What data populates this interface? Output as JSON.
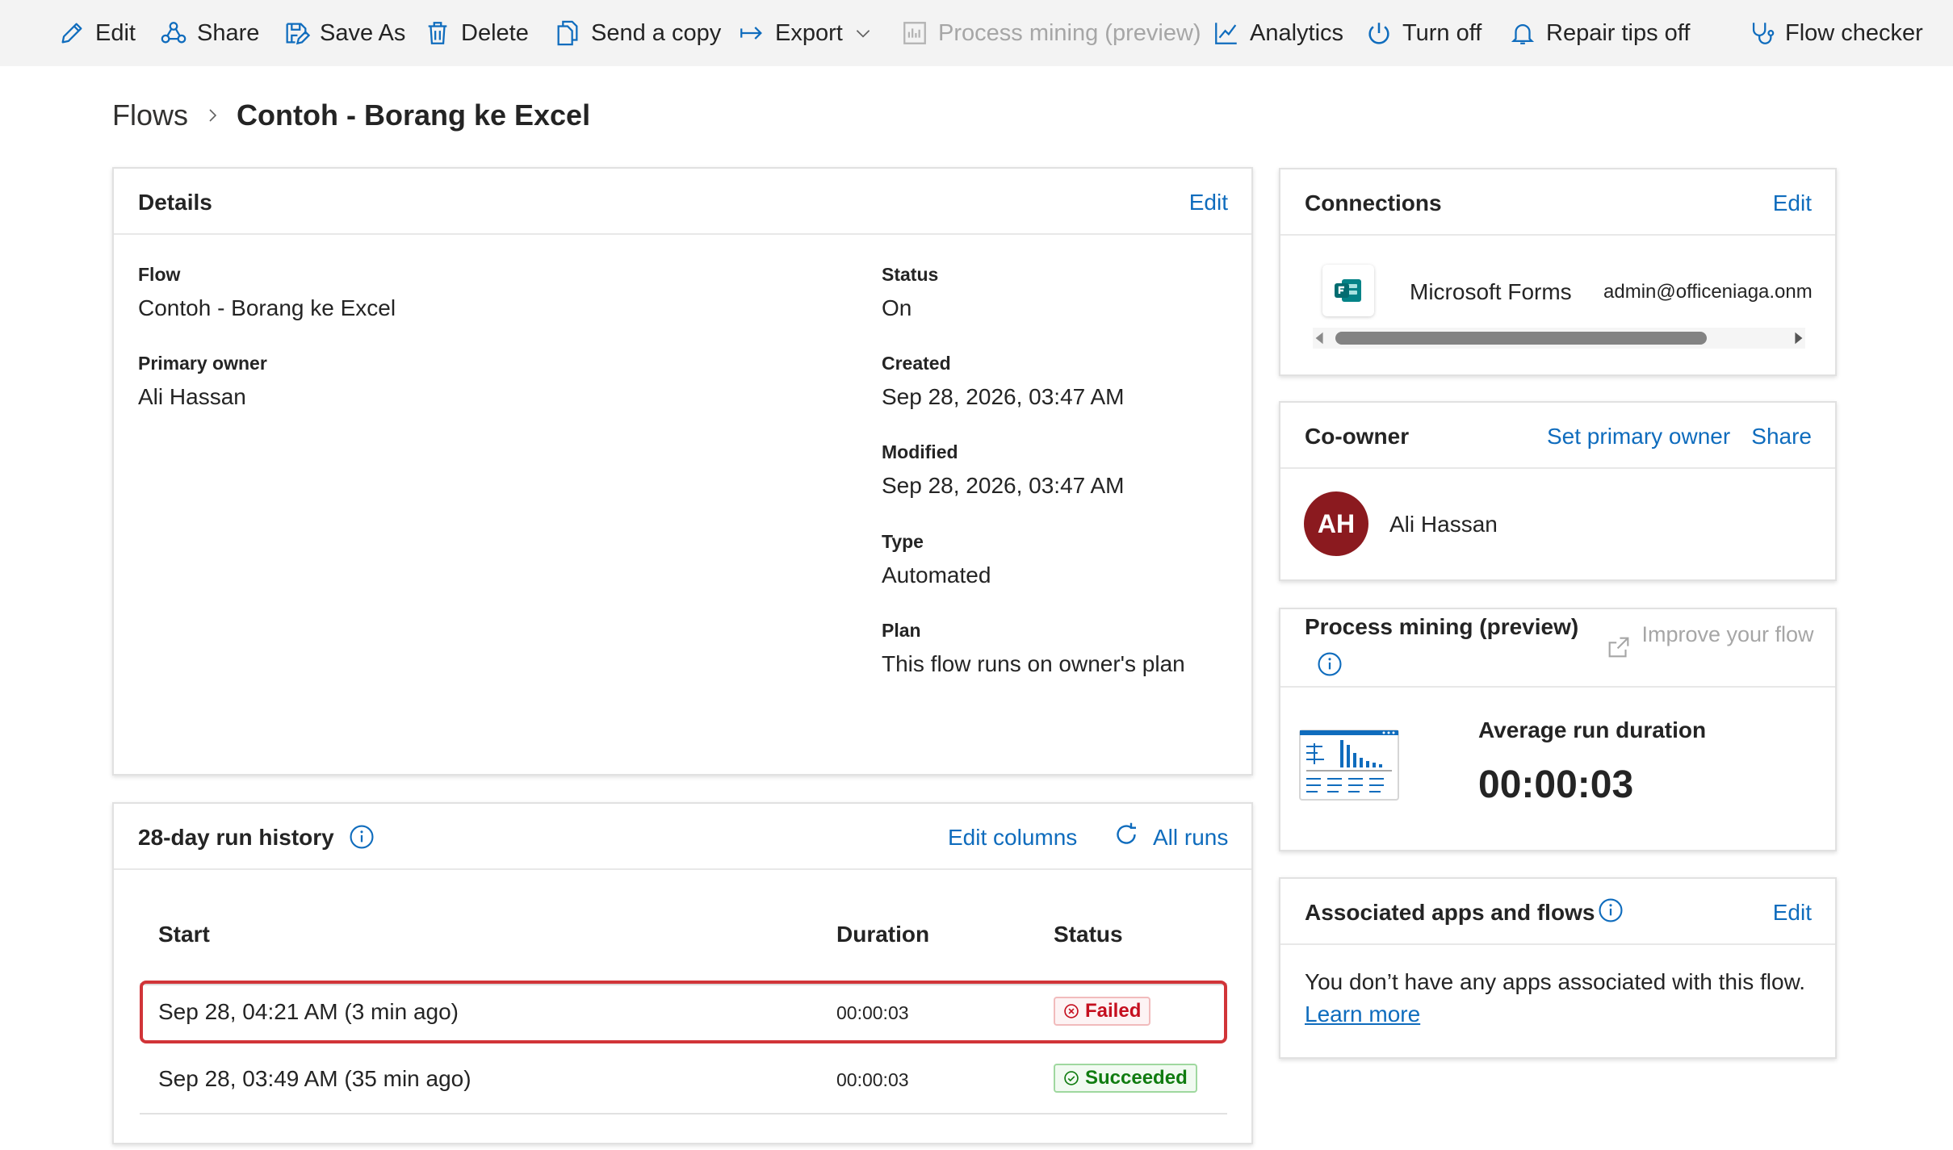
{
  "toolbar": {
    "edit": "Edit",
    "share": "Share",
    "save_as": "Save As",
    "delete": "Delete",
    "send_copy": "Send a copy",
    "export": "Export",
    "process_mining": "Process mining (preview)",
    "analytics": "Analytics",
    "turn_off": "Turn off",
    "repair_tips": "Repair tips off",
    "flow_checker": "Flow checker"
  },
  "breadcrumb": {
    "root": "Flows",
    "current": "Contoh - Borang ke Excel"
  },
  "details": {
    "title": "Details",
    "edit": "Edit",
    "flow_label": "Flow",
    "flow_value": "Contoh - Borang ke Excel",
    "owner_label": "Primary owner",
    "owner_value": "Ali Hassan",
    "status_label": "Status",
    "status_value": "On",
    "created_label": "Created",
    "created_value": "Sep 28, 2026, 03:47 AM",
    "modified_label": "Modified",
    "modified_value": "Sep 28, 2026, 03:47 AM",
    "type_label": "Type",
    "type_value": "Automated",
    "plan_label": "Plan",
    "plan_value": "This flow runs on owner's plan"
  },
  "run_history": {
    "title": "28-day run history",
    "edit_columns": "Edit columns",
    "all_runs": "All runs",
    "columns": {
      "start": "Start",
      "duration": "Duration",
      "status": "Status"
    },
    "rows": [
      {
        "start": "Sep 28, 04:21 AM (3 min ago)",
        "duration": "00:00:03",
        "status": "Failed"
      },
      {
        "start": "Sep 28, 03:49 AM (35 min ago)",
        "duration": "00:00:03",
        "status": "Succeeded"
      }
    ]
  },
  "connections": {
    "title": "Connections",
    "edit": "Edit",
    "items": [
      {
        "name": "Microsoft Forms",
        "account": "admin@officeniaga.onm"
      }
    ]
  },
  "coowner": {
    "title": "Co-owner",
    "set_primary": "Set primary owner",
    "share": "Share",
    "initials": "AH",
    "name": "Ali Hassan"
  },
  "process_mining": {
    "title": "Process mining (preview)",
    "improve": "Improve your flow",
    "avg_label": "Average run duration",
    "avg_value": "00:00:03"
  },
  "associated": {
    "title": "Associated apps and flows",
    "edit": "Edit",
    "empty_text": "You don’t have any apps associated with this flow.",
    "learn_more": "Learn more"
  },
  "colors": {
    "accent": "#0f6cbd",
    "failed": "#c50f1f",
    "succeeded": "#107c10",
    "highlight": "#d13438",
    "avatar": "#8b1a1f"
  }
}
